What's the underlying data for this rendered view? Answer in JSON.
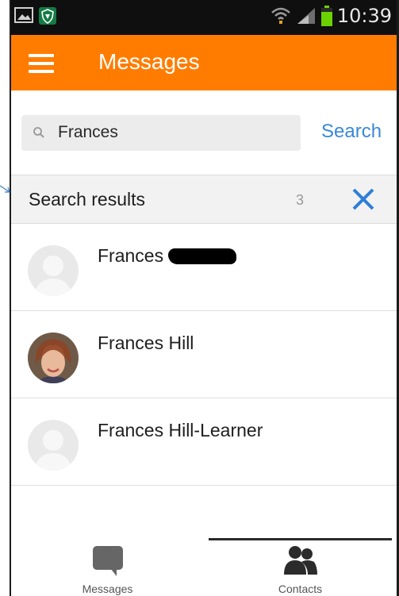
{
  "status_bar": {
    "time": "10:39",
    "icons": [
      "picture-icon",
      "shield-app-icon",
      "wifi-icon",
      "signal-icon",
      "battery-icon"
    ]
  },
  "app_bar": {
    "menu_icon": "hamburger-menu-icon",
    "title": "Messages",
    "background": "#ff7c00"
  },
  "search": {
    "icon": "search-icon",
    "value": "Frances",
    "button_label": "Search",
    "button_color": "#3a88d6"
  },
  "results": {
    "title": "Search results",
    "count": "3",
    "close_icon": "close-icon",
    "close_color": "#2f7fd8"
  },
  "contacts": [
    {
      "name": "Frances",
      "avatar": "default-avatar",
      "redacted_surname": true
    },
    {
      "name": "Frances Hill",
      "avatar": "photo-avatar",
      "redacted_surname": false
    },
    {
      "name": "Frances Hill-Learner",
      "avatar": "default-avatar",
      "redacted_surname": false
    }
  ],
  "bottom_nav": {
    "items": [
      {
        "label": "Messages",
        "icon": "chat-bubble-icon",
        "active": false
      },
      {
        "label": "Contacts",
        "icon": "contacts-icon",
        "active": true
      }
    ]
  }
}
